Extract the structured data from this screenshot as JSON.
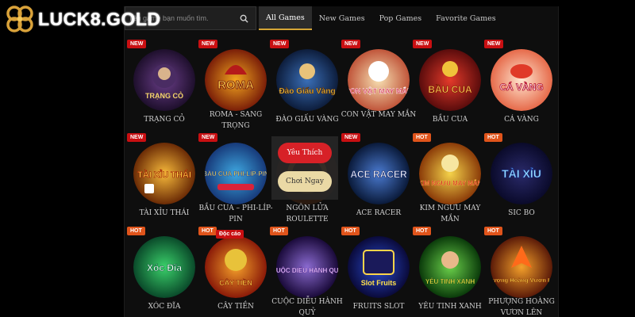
{
  "brand": {
    "name": "LUCK8.GOLD"
  },
  "search": {
    "placeholder": "Tên game bạn muốn tìm."
  },
  "tabs": [
    {
      "label": "All Games",
      "active": true
    },
    {
      "label": "New Games",
      "active": false
    },
    {
      "label": "Pop Games",
      "active": false
    },
    {
      "label": "Favorite Games",
      "active": false
    }
  ],
  "games": [
    {
      "name": "TRẠNG CỎ",
      "badge": "NEW",
      "art": "TRẠNG CỎ"
    },
    {
      "name": "ROMA - SANG TRỌNG",
      "badge": "NEW",
      "art": "ROMA"
    },
    {
      "name": "ĐÀO GIẤU VÀNG",
      "badge": "NEW",
      "art": "Đào Giấu Vàng"
    },
    {
      "name": "CON VẬT MAY MẮN",
      "badge": "NEW",
      "art": "CON VẬT MAY MẮN"
    },
    {
      "name": "BẦU CUA",
      "badge": "NEW",
      "art": "BẦU CUA"
    },
    {
      "name": "CÁ VÀNG",
      "badge": "NEW",
      "art": "CÁ VÀNG"
    },
    {
      "name": "TÀI XỈU THÁI",
      "badge": "NEW",
      "art": "TÀI XỈU THÁI"
    },
    {
      "name": "BẦU CUA – PHI-LÍP-PIN",
      "badge": "NEW",
      "art": "BẦU CUA PHI-LÍP-PIN"
    },
    {
      "name": "NGÔN LỬA ROULETTE",
      "badge": "",
      "art": ""
    },
    {
      "name": "ACE RACER",
      "badge": "NEW",
      "art": "ACE RACER"
    },
    {
      "name": "KIM NGƯU MAY MẮN",
      "badge": "HOT",
      "art": "KIM NGƯU MAY MẮN"
    },
    {
      "name": "SIC BO",
      "badge": "HOT",
      "art": "TÀI XỈU"
    },
    {
      "name": "XÓC ĐĨA",
      "badge": "HOT",
      "art": "Xóc Đĩa"
    },
    {
      "name": "CÂY TIỀN",
      "badge": "HOT",
      "art": "CÂY TIỀN"
    },
    {
      "name": "CUỘC DIỄU HÀNH QUỶ",
      "badge": "HOT",
      "art": "CUỘC DIỄU HÀNH QUỶ"
    },
    {
      "name": "FRUITS SLOT",
      "badge": "HOT",
      "art": "Slot Fruits"
    },
    {
      "name": "YÊU TINH XANH",
      "badge": "HOT",
      "art": "YÊU TINH XANH"
    },
    {
      "name": "PHƯỢNG HOÀNG VƯƠN LÊN",
      "badge": "HOT",
      "art": "Phượng Hoàng Vươn Lên"
    }
  ],
  "hover_menu": {
    "favorite": "Yêu Thích",
    "play": "Chơi Ngay"
  },
  "extra_badge": "Độc cáo",
  "colors": {
    "accent": "#d6a636",
    "new_badge": "#c90f12",
    "hot_badge": "#e0541b",
    "favorite_button": "#d72127",
    "play_button": "#ead9a5"
  }
}
